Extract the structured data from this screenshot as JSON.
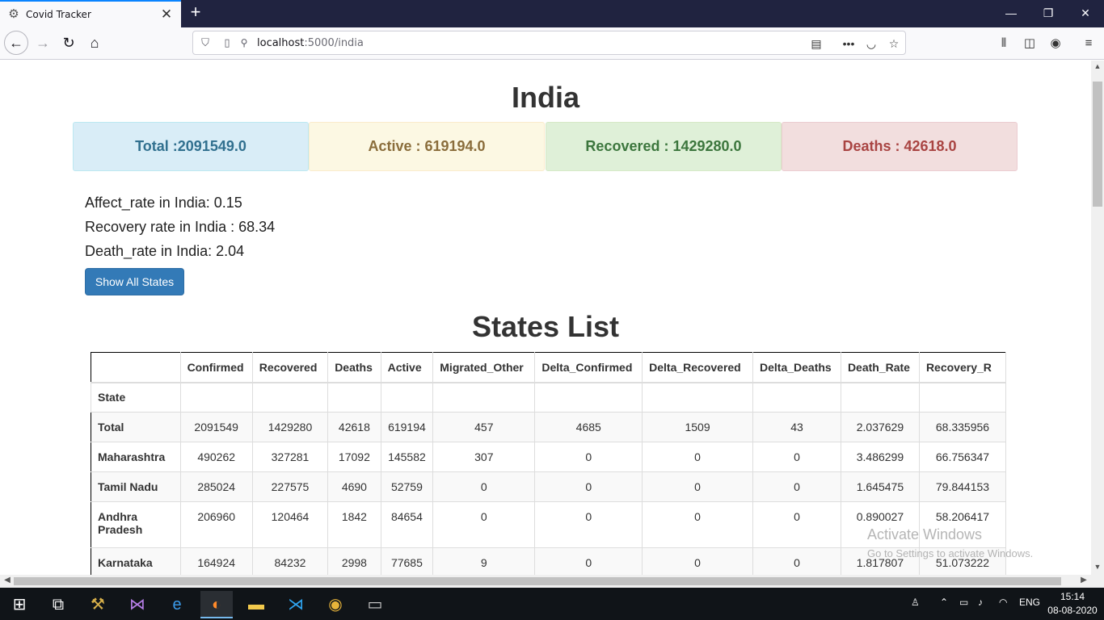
{
  "browser": {
    "tab_title": "Covid Tracker",
    "url_host": "localhost",
    "url_path": ":5000/india",
    "icons": [
      "settings-icon",
      "close-icon",
      "plus-icon",
      "minimize-icon",
      "restore-icon",
      "back-icon",
      "forward-icon",
      "reload-icon",
      "home-icon",
      "shield-icon",
      "page-icon",
      "permissions-icon",
      "reader-view-icon",
      "more-icon",
      "pocket-icon",
      "bookmark-star-icon",
      "library-icon",
      "sidebar-icon",
      "account-icon",
      "menu-icon"
    ]
  },
  "page": {
    "title": "India",
    "cards": {
      "total": "Total :2091549.0",
      "active": "Active : 619194.0",
      "recovered": "Recovered : 1429280.0",
      "deaths": "Deaths : 42618.0"
    },
    "colors": {
      "info": "#d9edf7",
      "warning": "#fcf8e3",
      "success": "#dff0d8",
      "danger": "#f2dede",
      "primary_button": "#337ab7"
    },
    "rates": {
      "affect": "Affect_rate in India: 0.15",
      "recovery": "Recovery rate in India : 68.34",
      "death": "Death_rate in India: 2.04"
    },
    "show_all_button": "Show All States",
    "states_title": "States List"
  },
  "table": {
    "columns": [
      "",
      "Confirmed",
      "Recovered",
      "Deaths",
      "Active",
      "Migrated_Other",
      "Delta_Confirmed",
      "Delta_Recovered",
      "Delta_Deaths",
      "Death_Rate",
      "Recovery_R"
    ],
    "index_label": "State",
    "rows": [
      [
        "Total",
        "2091549",
        "1429280",
        "42618",
        "619194",
        "457",
        "4685",
        "1509",
        "43",
        "2.037629",
        "68.335956"
      ],
      [
        "Maharashtra",
        "490262",
        "327281",
        "17092",
        "145582",
        "307",
        "0",
        "0",
        "0",
        "3.486299",
        "66.756347"
      ],
      [
        "Tamil Nadu",
        "285024",
        "227575",
        "4690",
        "52759",
        "0",
        "0",
        "0",
        "0",
        "1.645475",
        "79.844153"
      ],
      [
        "Andhra Pradesh",
        "206960",
        "120464",
        "1842",
        "84654",
        "0",
        "0",
        "0",
        "0",
        "0.890027",
        "58.206417"
      ],
      [
        "Karnataka",
        "164924",
        "84232",
        "2998",
        "77685",
        "9",
        "0",
        "0",
        "0",
        "1.817807",
        "51.073222"
      ]
    ]
  },
  "watermark": {
    "line1": "Activate Windows",
    "line2": "Go to Settings to activate Windows."
  },
  "taskbar": {
    "language": "ENG",
    "time": "15:14",
    "date": "08-08-2020",
    "icons": [
      "windows-start-icon",
      "task-view-icon",
      "tools-icon",
      "visual-studio-icon",
      "edge-icon",
      "firefox-icon",
      "file-explorer-icon",
      "vscode-icon",
      "chrome-icon",
      "terminal-icon",
      "people-icon",
      "chevron-up-icon",
      "battery-icon",
      "volume-icon",
      "wifi-icon"
    ]
  }
}
